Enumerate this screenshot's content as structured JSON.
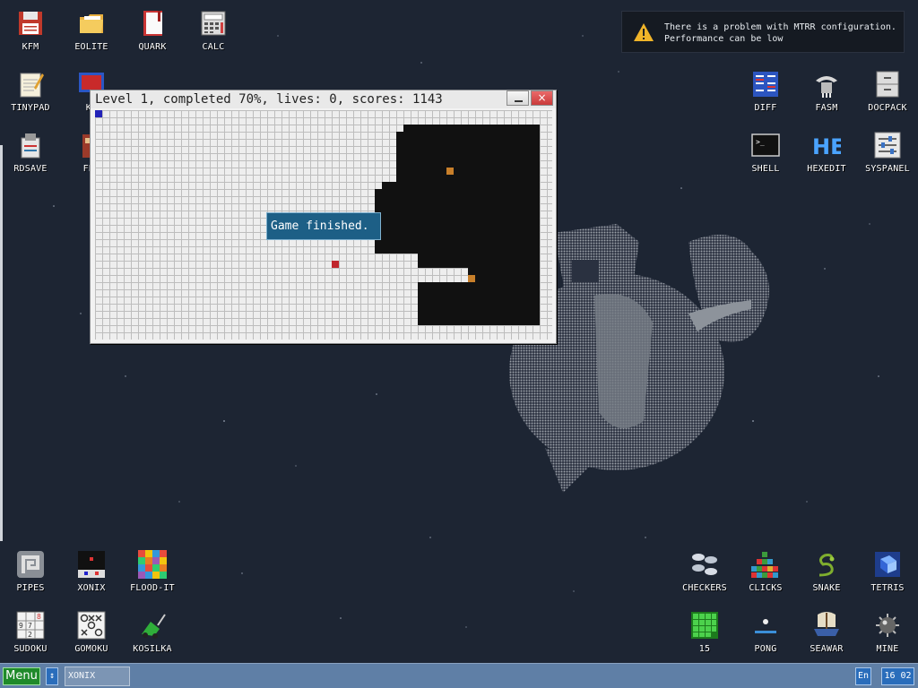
{
  "desktop": {
    "icons_top_left": [
      {
        "label": "KFM",
        "icon": "floppy-icon"
      },
      {
        "label": "EOLITE",
        "icon": "folder-icon"
      },
      {
        "label": "QUARK",
        "icon": "notebook-icon"
      },
      {
        "label": "CALC",
        "icon": "calculator-icon"
      },
      {
        "label": "TINYPAD",
        "icon": "notepad-icon"
      },
      {
        "label": "KF",
        "icon": "monitor-icon"
      },
      {
        "label": "RDSAVE",
        "icon": "save-disk-icon"
      },
      {
        "label": "FB2",
        "icon": "book-icon"
      }
    ],
    "icons_top_right": [
      {
        "label": "DIFF",
        "icon": "diff-icon"
      },
      {
        "label": "FASM",
        "icon": "fasm-icon"
      },
      {
        "label": "DOCPACK",
        "icon": "cabinet-icon"
      },
      {
        "label": "SHELL",
        "icon": "terminal-icon"
      },
      {
        "label": "HEXEDIT",
        "icon": "hex-icon"
      },
      {
        "label": "SYSPANEL",
        "icon": "sliders-icon"
      }
    ],
    "icons_bottom_left": [
      {
        "label": "PIPES",
        "icon": "pipes-icon"
      },
      {
        "label": "XONIX",
        "icon": "xonix-icon"
      },
      {
        "label": "FLOOD-IT",
        "icon": "flood-icon"
      },
      {
        "label": "SUDOKU",
        "icon": "sudoku-icon"
      },
      {
        "label": "GOMOKU",
        "icon": "gomoku-icon"
      },
      {
        "label": "KOSILKA",
        "icon": "mower-icon"
      }
    ],
    "icons_bottom_right": [
      {
        "label": "CHECKERS",
        "icon": "checkers-icon"
      },
      {
        "label": "CLICKS",
        "icon": "clicks-icon"
      },
      {
        "label": "SNAKE",
        "icon": "snake-icon"
      },
      {
        "label": "TETRIS",
        "icon": "tetris-icon"
      },
      {
        "label": "15",
        "icon": "fifteen-icon"
      },
      {
        "label": "PONG",
        "icon": "pong-icon"
      },
      {
        "label": "SEAWAR",
        "icon": "seawar-icon"
      },
      {
        "label": "MINE",
        "icon": "mine-icon"
      }
    ]
  },
  "notification": {
    "line1": "There is a problem with MTRR configuration.",
    "line2": "Performance can be low",
    "icon": "warning-icon"
  },
  "game_window": {
    "title": "Level 1, completed 70%, lives: 0, scores: 1143",
    "minimize_label": "_",
    "close_label": "×",
    "message": "Game finished."
  },
  "taskbar": {
    "menu_label": "Menu",
    "switch_label": "↕",
    "task_label": "XONIX",
    "language": "En",
    "clock": "16 02"
  },
  "colors": {
    "desktop_bg": "#1d2533",
    "taskbar": "#5f7fa6",
    "menu_button": "#1f8a2a",
    "message_bg": "#1d5f86"
  }
}
